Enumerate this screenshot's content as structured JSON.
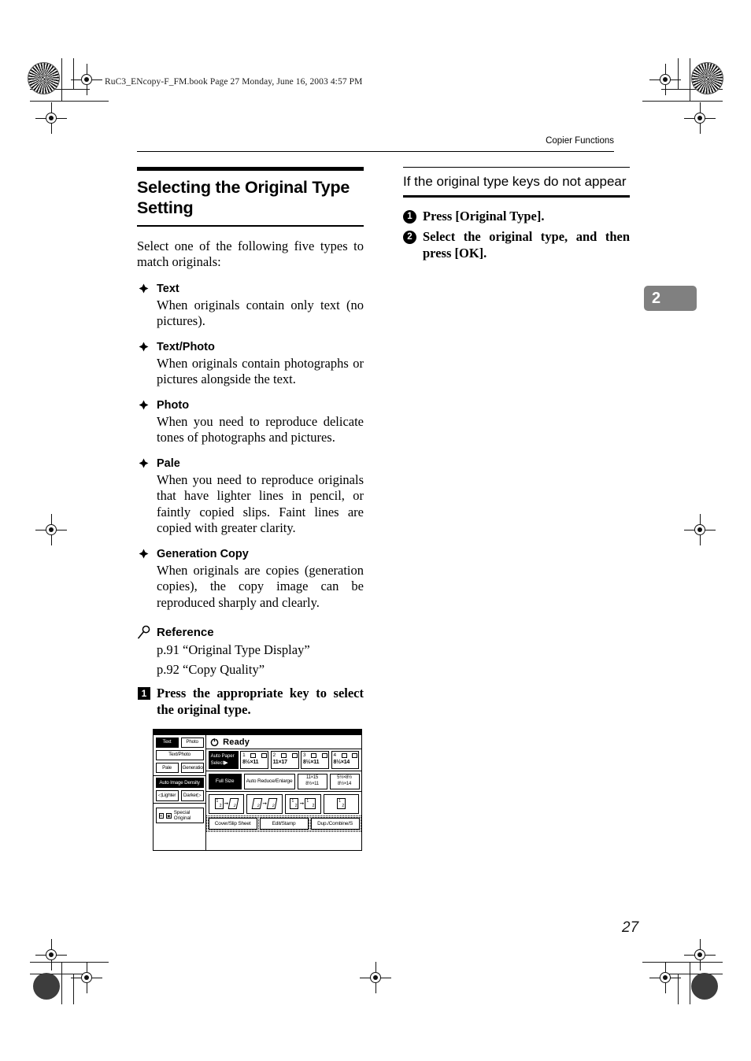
{
  "book_header": "RuC3_ENcopy-F_FM.book  Page 27  Monday, June 16, 2003  4:57 PM",
  "running_head": "Copier Functions",
  "chapter_tab": "2",
  "page_number": "27",
  "left_column": {
    "section_title": "Selecting the Original Type Setting",
    "intro": "Select one of the following five types to match originals:",
    "types": [
      {
        "name": "Text",
        "description": "When originals contain only text (no pictures)."
      },
      {
        "name": "Text/Photo",
        "description": "When originals contain photographs or pictures alongside the text."
      },
      {
        "name": "Photo",
        "description": "When you need to reproduce delicate tones of photographs and pictures."
      },
      {
        "name": "Pale",
        "description": "When you need to reproduce originals that have lighter lines in pencil, or faintly copied slips. Faint lines are copied with greater clarity."
      },
      {
        "name": "Generation Copy",
        "description": "When originals are copies (generation copies), the copy image can be reproduced sharply and clearly."
      }
    ],
    "reference": {
      "label": "Reference",
      "links": [
        "p.91 “Original Type Display”",
        "p.92 “Copy Quality”"
      ]
    },
    "step_1": {
      "number": "1",
      "text": "Press the appropriate key to select the original type."
    }
  },
  "right_column": {
    "sub_title": "If the original type keys do not appear",
    "steps": [
      {
        "number": "1",
        "text": "Press [Original Type]."
      },
      {
        "number": "2",
        "text": "Select the original type, and then press [OK]."
      }
    ]
  },
  "lcd_panel": {
    "status": "Ready",
    "original_type_keys": [
      {
        "label": "Text",
        "selected": true
      },
      {
        "label": "Photo",
        "selected": false
      },
      {
        "label": "Text/Photo",
        "selected": false
      },
      {
        "label": "Pale",
        "selected": false
      },
      {
        "label": "Generation",
        "selected": false
      }
    ],
    "auto_image_density": "Auto Image Density",
    "density_keys": [
      {
        "label": "◁Lighter"
      },
      {
        "label": "Darker▷"
      }
    ],
    "special_original": "Special Original",
    "paper_select": {
      "label_line1": "Auto Paper",
      "label_line2": "Select",
      "arrow": "▶"
    },
    "trays": [
      {
        "num": "1",
        "size": "8½×11"
      },
      {
        "num": "2",
        "size": "11×17"
      },
      {
        "num": "3",
        "size": "8½×11"
      },
      {
        "num": "4",
        "size": "8½×14"
      }
    ],
    "zoom_keys": [
      {
        "label": "Full Size",
        "selected": true
      },
      {
        "label": "Auto Reduce/Enlarge",
        "selected": false
      }
    ],
    "ratios": [
      {
        "top": "11×15",
        "bottom": "8½×11"
      },
      {
        "top": "5½×8½",
        "bottom": "8½×14"
      }
    ],
    "duplex_keys": [
      {
        "from": "1|2",
        "to": "1/2"
      },
      {
        "from": "1/2",
        "to": "1/2"
      },
      {
        "from": "1|2",
        "to": "1:2"
      },
      {
        "from": "1|2",
        "to": ""
      }
    ],
    "function_keys": [
      "Cover/Slip Sheet",
      "Edit/Stamp",
      "Dup./Combine/S"
    ]
  }
}
